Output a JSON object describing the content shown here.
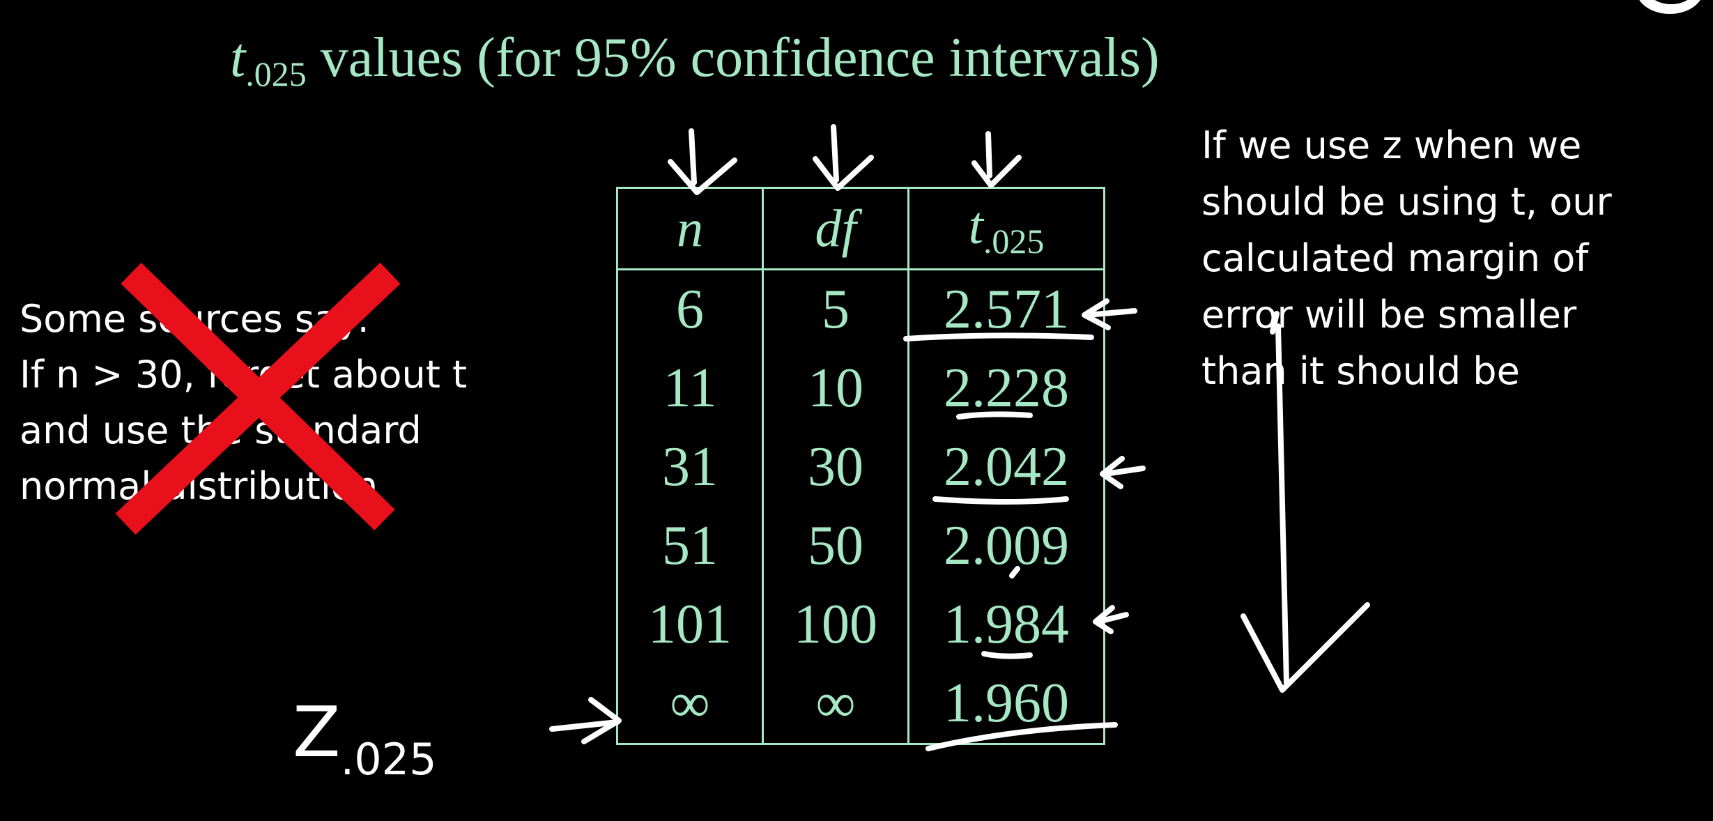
{
  "title": {
    "symbol": "t",
    "subscript": ".025",
    "rest": " values (for 95% confidence intervals)"
  },
  "left_note": {
    "lines": [
      "Some sources say:",
      "If n > 30, forget about t",
      "and use the standard",
      "normal distribution"
    ]
  },
  "right_note": {
    "lines": [
      "If we use z when we",
      "should be using t, our",
      "calculated margin of",
      "error will be smaller",
      "than it should be"
    ]
  },
  "table": {
    "headers": [
      {
        "main": "n",
        "sub": ""
      },
      {
        "main": "df",
        "sub": ""
      },
      {
        "main": "t",
        "sub": ".025"
      }
    ],
    "rows": [
      [
        "6",
        "5",
        "2.571"
      ],
      [
        "11",
        "10",
        "2.228"
      ],
      [
        "31",
        "30",
        "2.042"
      ],
      [
        "51",
        "50",
        "2.009"
      ],
      [
        "101",
        "100",
        "1.984"
      ],
      [
        "∞",
        "∞",
        "1.960"
      ]
    ]
  },
  "z_label": {
    "main": "Z",
    "sub": ".025"
  },
  "badge": {
    "letter": "B"
  },
  "colors": {
    "background": "#000000",
    "accent": "#a6e8c4",
    "ink": "#ffffff",
    "cross": "#e8101a"
  },
  "icons": [
    "cross-out-mark",
    "down-arrow-icon",
    "pointer-arrow-icon",
    "badge-logo"
  ]
}
